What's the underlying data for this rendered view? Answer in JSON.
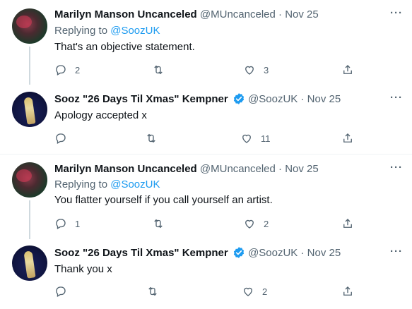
{
  "tweets": [
    {
      "name": "Marilyn Manson Uncanceled",
      "handle": "@MUncanceled",
      "sep": "·",
      "date": "Nov 25",
      "replying_prefix": "Replying to ",
      "replying_to": "@SoozUK",
      "text": "That's an objective statement.",
      "replies": "2",
      "likes": "3"
    },
    {
      "name": "Sooz \"26 Days Til Xmas\" Kempner",
      "handle": "@SoozUK",
      "sep": "·",
      "date": "Nov 25",
      "text": "Apology accepted x",
      "replies": "",
      "likes": "11"
    },
    {
      "name": "Marilyn Manson Uncanceled",
      "handle": "@MUncanceled",
      "sep": "·",
      "date": "Nov 25",
      "replying_prefix": "Replying to ",
      "replying_to": "@SoozUK",
      "text": "You flatter yourself if you call yourself an artist.",
      "replies": "1",
      "likes": "2"
    },
    {
      "name": "Sooz \"26 Days Til Xmas\" Kempner",
      "handle": "@SoozUK",
      "sep": "·",
      "date": "Nov 25",
      "text": "Thank you x",
      "replies": "",
      "likes": "2"
    }
  ],
  "more_label": "···",
  "colors": {
    "link": "#1d9bf0",
    "muted": "#536471",
    "verified": "#1d9bf0"
  }
}
